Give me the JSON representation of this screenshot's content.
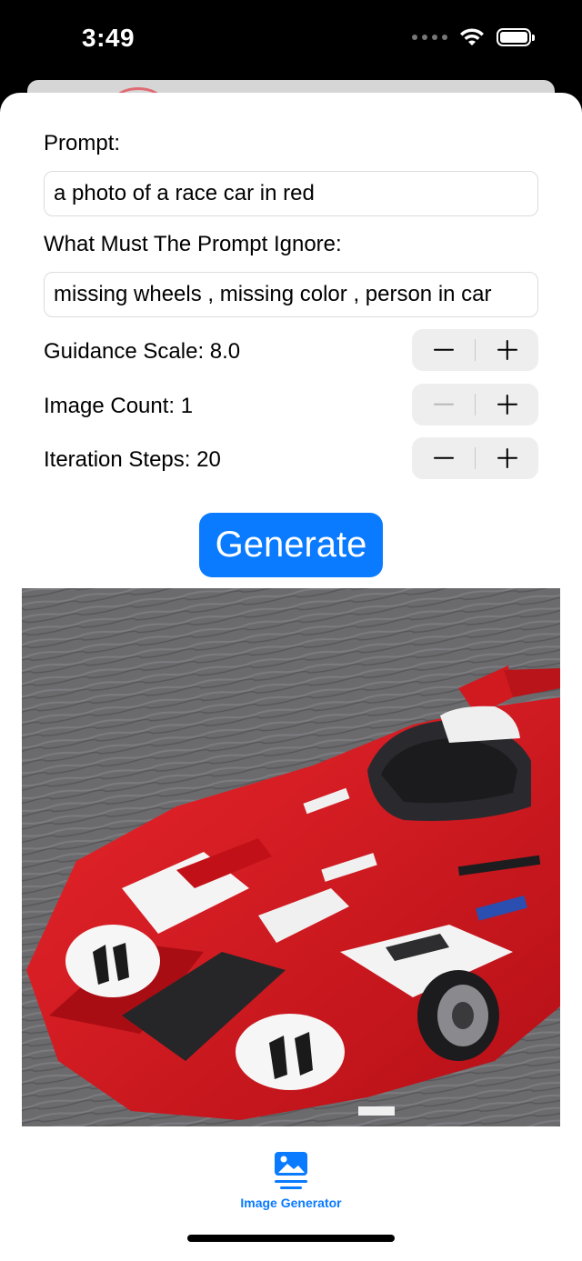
{
  "status_bar": {
    "time": "3:49"
  },
  "form": {
    "prompt_label": "Prompt:",
    "prompt_value": "a photo of a race car in red",
    "negative_label": "What Must The Prompt Ignore:",
    "negative_value": "missing wheels , missing color , person in car",
    "guidance_label": "Guidance Scale: 8.0",
    "image_count_label": "Image Count: 1",
    "steps_label": "Iteration Steps: 20"
  },
  "generate_label": "Generate",
  "tab_bar": {
    "items": [
      {
        "label": "Image Generator",
        "icon": "photo-icon",
        "selected": true
      }
    ]
  },
  "colors": {
    "accent": "#0a7aff",
    "stepper_bg": "#eeeeef",
    "car_red": "#d8141c"
  }
}
